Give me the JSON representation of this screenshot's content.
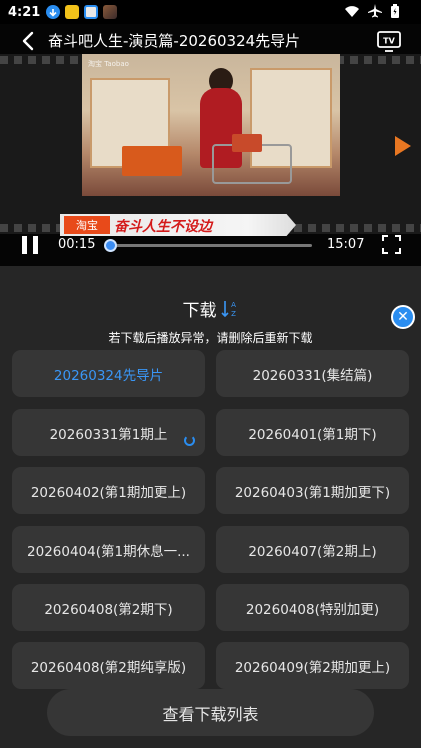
{
  "status_bar": {
    "time": "4:21",
    "notification_icons": [
      "download-notif-icon",
      "lottery-notif-icon",
      "app-notif-icon",
      "image-notif-icon"
    ],
    "system_icons": [
      "wifi-icon",
      "airplane-icon",
      "battery-icon"
    ]
  },
  "player": {
    "title": "奋斗吧人生-演员篇-20260324先导片",
    "cast_icon": "tv-cast-icon",
    "video_watermark": "淘宝 Taobao",
    "banner_tag": "淘宝",
    "banner_text": "奋斗人生不设边",
    "current_time": "00:15",
    "total_time": "15:07",
    "progress": 0.017,
    "accent_color": "#2a8df0"
  },
  "download_panel": {
    "title": "下载",
    "hint": "若下载后播放异常，请删除后重新下载",
    "episodes": [
      {
        "label": "20260324先导片",
        "state": "selected"
      },
      {
        "label": "20260331(集结篇)",
        "state": "normal"
      },
      {
        "label": "20260331第1期上",
        "state": "downloading"
      },
      {
        "label": "20260401(第1期下)",
        "state": "normal"
      },
      {
        "label": "20260402(第1期加更上)",
        "state": "normal"
      },
      {
        "label": "20260403(第1期加更下)",
        "state": "normal"
      },
      {
        "label": "20260404(第1期休息一...",
        "state": "normal"
      },
      {
        "label": "20260407(第2期上)",
        "state": "normal"
      },
      {
        "label": "20260408(第2期下)",
        "state": "normal"
      },
      {
        "label": "20260408(特别加更)",
        "state": "normal"
      },
      {
        "label": "20260408(第2期纯享版)",
        "state": "normal"
      },
      {
        "label": "20260409(第2期加更上)",
        "state": "normal"
      }
    ],
    "view_list_label": "查看下载列表"
  }
}
